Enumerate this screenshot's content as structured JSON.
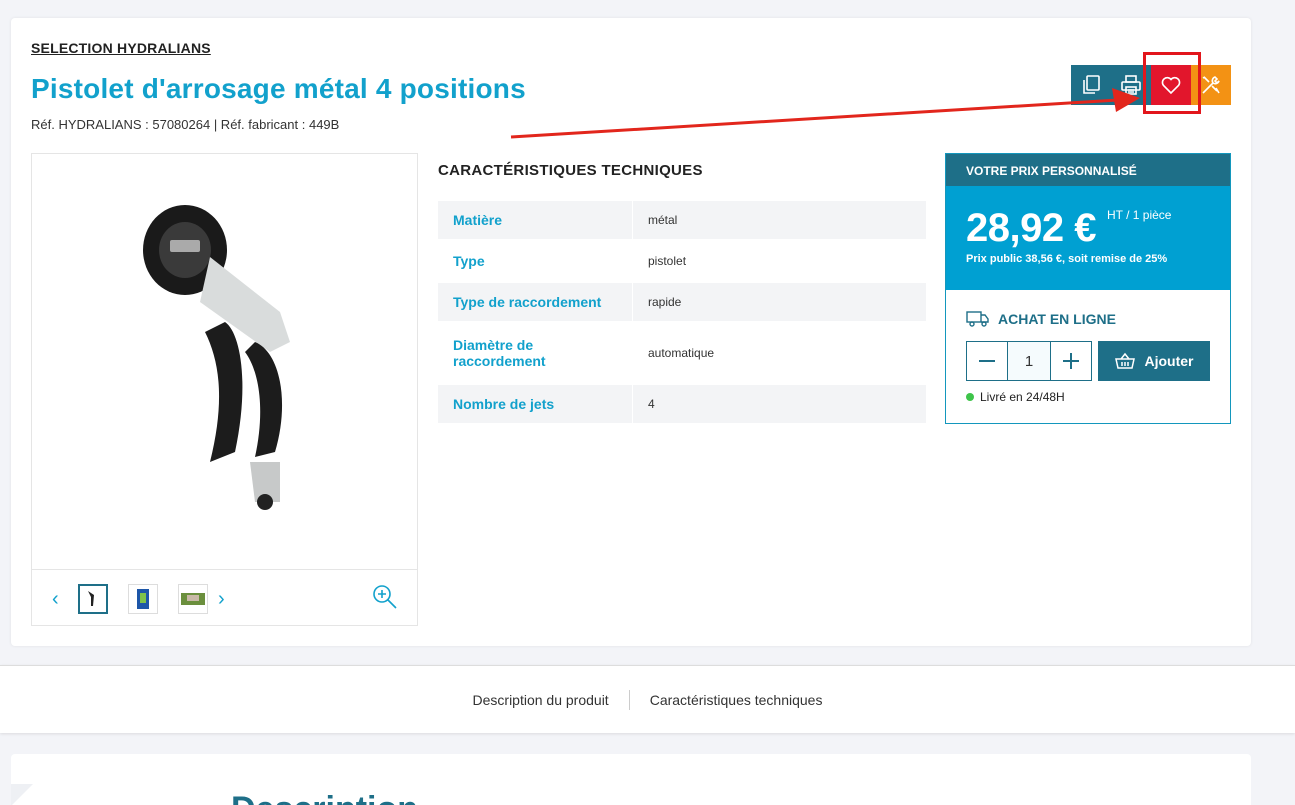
{
  "product": {
    "brand": "SELECTION HYDRALIANS",
    "title": "Pistolet d'arrosage métal 4 positions",
    "refs": "Réf. HYDRALIANS : 57080264 | Réf. fabricant : 449B"
  },
  "actions": [
    {
      "icon": "copy-icon"
    },
    {
      "icon": "print-icon"
    },
    {
      "icon": "heart-icon"
    },
    {
      "icon": "tools-icon"
    }
  ],
  "colors": {
    "accent": "#12a1cc",
    "dark_blue": "#1e6f88",
    "favorite_red": "#e2162c",
    "tools_orange": "#f39214",
    "highlight_red": "#e2161c"
  },
  "specs": {
    "title": "CARACTÉRISTIQUES TECHNIQUES",
    "rows": [
      {
        "key": "Matière",
        "value": "métal"
      },
      {
        "key": "Type",
        "value": "pistolet"
      },
      {
        "key": "Type de raccordement",
        "value": "rapide"
      },
      {
        "key": "Diamètre de raccordement",
        "value": "automatique"
      },
      {
        "key": "Nombre de jets",
        "value": "4"
      }
    ]
  },
  "price": {
    "header": "VOTRE PRIX PERSONNALISÉ",
    "amount": "28,92 €",
    "unit": "HT / 1 pièce",
    "public": "Prix public 38,56 €, soit remise de 25%"
  },
  "buy": {
    "label": "ACHAT EN LIGNE",
    "quantity": "1",
    "add_label": "Ajouter",
    "delivery": "Livré en 24/48H"
  },
  "tabs": [
    {
      "label": "Description du produit"
    },
    {
      "label": "Caractéristiques techniques"
    }
  ],
  "description": {
    "title": "Description"
  }
}
